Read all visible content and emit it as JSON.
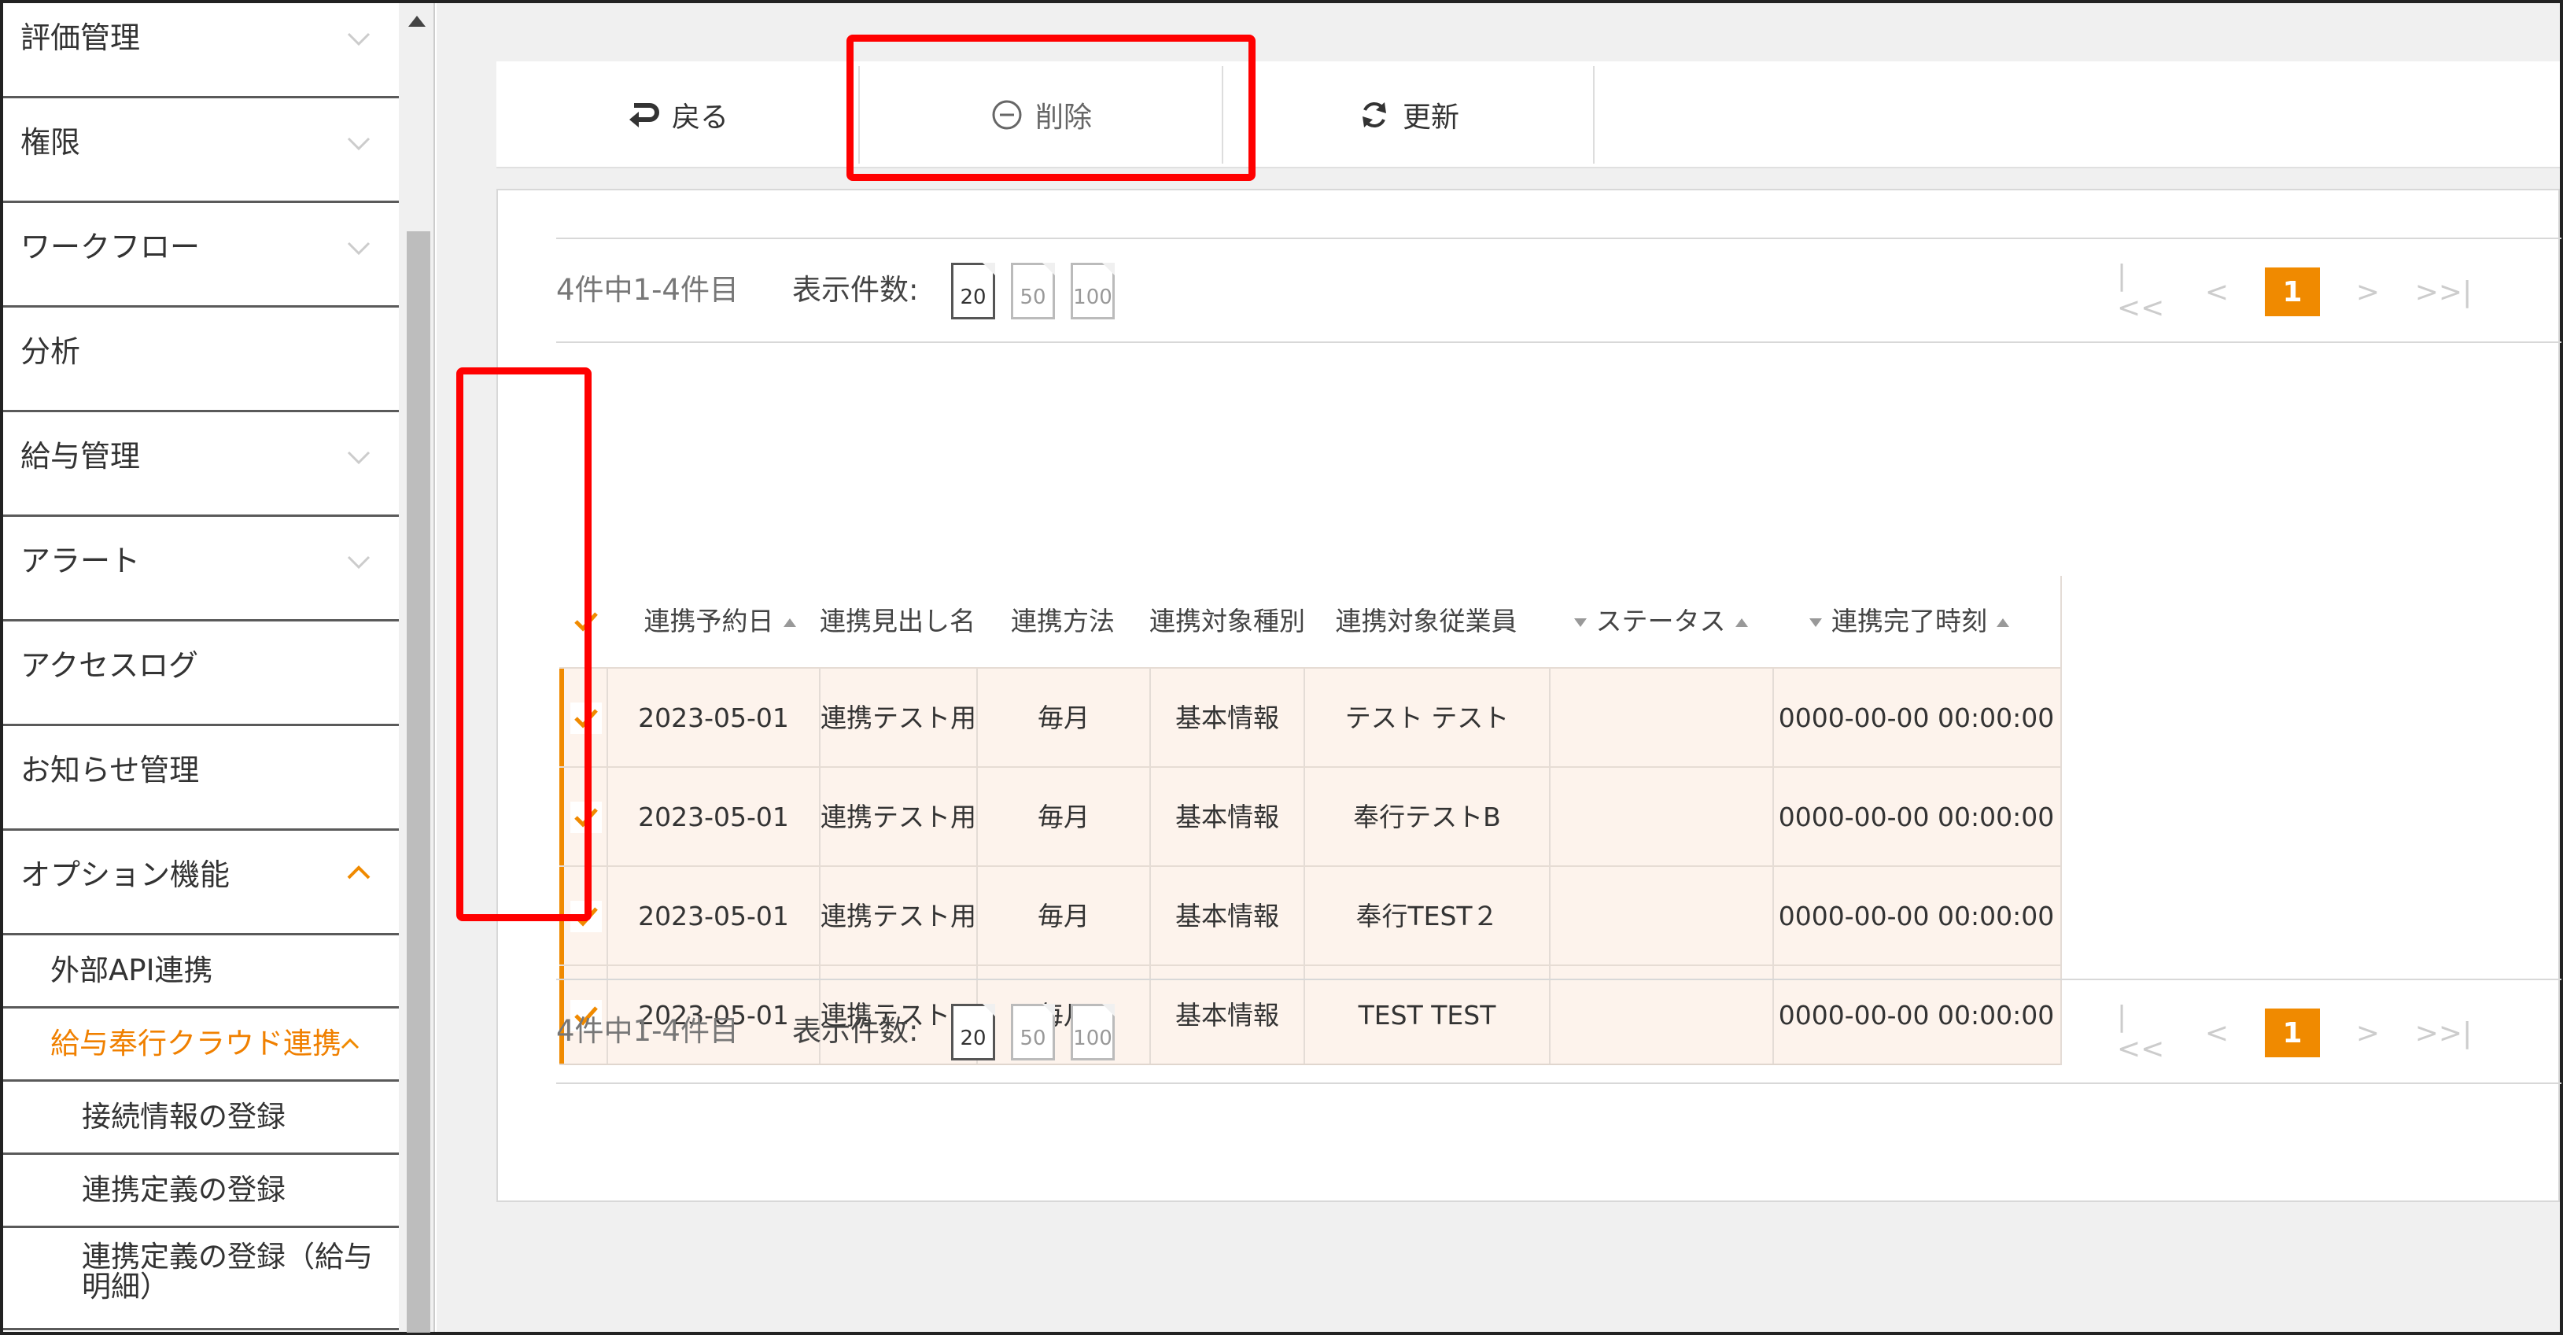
{
  "sidebar": {
    "items": [
      {
        "label": "評価管理"
      },
      {
        "label": "権限"
      },
      {
        "label": "ワークフロー"
      },
      {
        "label": "分析"
      },
      {
        "label": "給与管理"
      },
      {
        "label": "アラート"
      },
      {
        "label": "アクセスログ"
      },
      {
        "label": "お知らせ管理"
      },
      {
        "label": "オプション機能"
      }
    ],
    "sub": {
      "external_api": "外部API連携",
      "kyuyo_bugyo": "給与奉行クラウド連携",
      "connection_info": "接続情報の登録",
      "link_definition": "連携定義の登録",
      "link_definition_payslip": "連携定義の登録（給与明細）"
    }
  },
  "toolbar": {
    "back_label": "戻る",
    "delete_label": "削除",
    "refresh_label": "更新"
  },
  "pager": {
    "count_text": "4件中1-4件目",
    "page_size_label": "表示件数:",
    "page_sizes": [
      "20",
      "50",
      "100"
    ],
    "selected_page_size": "20",
    "current_page": "1"
  },
  "table": {
    "columns": [
      "連携予約日",
      "連携見出し名",
      "連携方法",
      "連携対象種別",
      "連携対象従業員",
      "ステータス",
      "連携完了時刻"
    ],
    "rows": [
      {
        "date": "2023-05-01",
        "title": "連携テスト用",
        "method": "毎月",
        "type": "基本情報",
        "employee": "テスト テスト",
        "status": "",
        "completed": "0000-00-00 00:00:00"
      },
      {
        "date": "2023-05-01",
        "title": "連携テスト用",
        "method": "毎月",
        "type": "基本情報",
        "employee": "奉行テストB",
        "status": "",
        "completed": "0000-00-00 00:00:00"
      },
      {
        "date": "2023-05-01",
        "title": "連携テスト用",
        "method": "毎月",
        "type": "基本情報",
        "employee": "奉行TEST２",
        "status": "",
        "completed": "0000-00-00 00:00:00"
      },
      {
        "date": "2023-05-01",
        "title": "連携テスト用",
        "method": "毎月",
        "type": "基本情報",
        "employee": "TEST TEST",
        "status": "",
        "completed": "0000-00-00 00:00:00"
      }
    ]
  },
  "colors": {
    "accent": "#f08a00",
    "highlight": "#ff0000",
    "row_selected_bg": "#fdf3ec"
  }
}
